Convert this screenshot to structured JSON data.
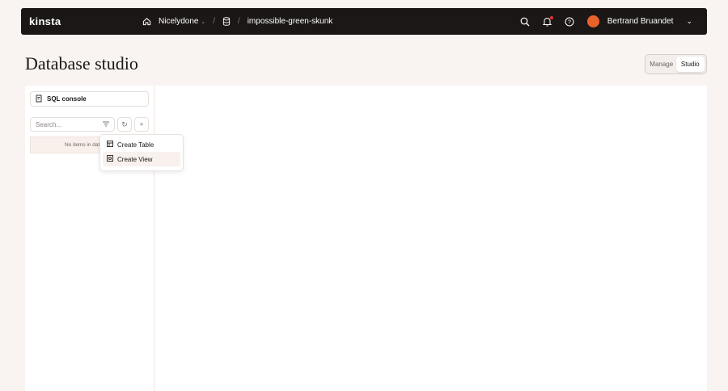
{
  "topbar": {
    "logo": "kinsta",
    "company": "Nicelydone",
    "database": "impossible-green-skunk",
    "user": "Bertrand Bruandet"
  },
  "page": {
    "title": "Database studio",
    "tabs": [
      "Manage",
      "Studio"
    ],
    "active_tab": "Studio"
  },
  "sidebar": {
    "sql_console": "SQL console",
    "search_placeholder": "Search...",
    "empty_text": "No items in database"
  },
  "menu": {
    "items": [
      "Create Table",
      "Create View"
    ]
  },
  "colors": {
    "topbar": "#1b1716",
    "accent": "#e8632b",
    "background": "#f9f4f1"
  }
}
